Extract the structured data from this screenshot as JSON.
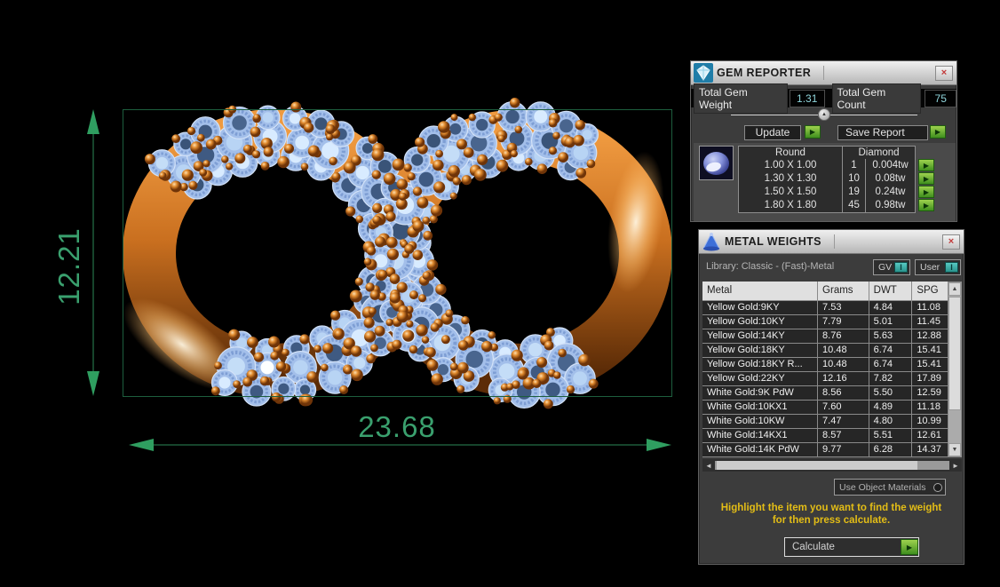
{
  "viewport": {
    "dim_width": "23.68",
    "dim_height": "12.21"
  },
  "colors": {
    "dimension_green": "#3aa06e",
    "value_cyan": "#8fd4da",
    "hint_yellow": "#e3bd16",
    "action_green": "#3f8f1e",
    "metal_orange": "#c96f1f",
    "gem_blue": "#a3bfea"
  },
  "gem_reporter": {
    "title": "GEM REPORTER",
    "close_glyph": "×",
    "total_weight_label": "Total Gem Weight",
    "total_weight_value": "1.31",
    "total_count_label": "Total Gem Count",
    "total_count_value": "75",
    "update_label": "Update",
    "save_report_label": "Save Report",
    "run_glyph": "▶",
    "table": {
      "shape_header": "Round",
      "type_header": "Diamond",
      "rows": [
        {
          "size": "1.00 X 1.00",
          "count": "1",
          "weight": "0.004tw"
        },
        {
          "size": "1.30 X 1.30",
          "count": "10",
          "weight": "0.08tw"
        },
        {
          "size": "1.50 X 1.50",
          "count": "19",
          "weight": "0.24tw"
        },
        {
          "size": "1.80 X 1.80",
          "count": "45",
          "weight": "0.98tw"
        }
      ]
    }
  },
  "metal_weights": {
    "title": "METAL WEIGHTS",
    "close_glyph": "×",
    "library_label": "Library: Classic - (Fast)-Metal",
    "gv_label": "GV",
    "user_label": "User",
    "toggle_glyph": "I",
    "columns": [
      "Metal",
      "Grams",
      "DWT",
      "SPG"
    ],
    "rows": [
      [
        "Yellow Gold:9KY",
        "7.53",
        "4.84",
        "11.08"
      ],
      [
        "Yellow Gold:10KY",
        "7.79",
        "5.01",
        "11.45"
      ],
      [
        "Yellow Gold:14KY",
        "8.76",
        "5.63",
        "12.88"
      ],
      [
        "Yellow Gold:18KY",
        "10.48",
        "6.74",
        "15.41"
      ],
      [
        "Yellow Gold:18KY R...",
        "10.48",
        "6.74",
        "15.41"
      ],
      [
        "Yellow Gold:22KY",
        "12.16",
        "7.82",
        "17.89"
      ],
      [
        "White Gold:9K PdW",
        "8.56",
        "5.50",
        "12.59"
      ],
      [
        "White Gold:10KX1",
        "7.60",
        "4.89",
        "11.18"
      ],
      [
        "White Gold:10KW",
        "7.47",
        "4.80",
        "10.99"
      ],
      [
        "White Gold:14KX1",
        "8.57",
        "5.51",
        "12.61"
      ],
      [
        "White Gold:14K PdW",
        "9.77",
        "6.28",
        "14.37"
      ]
    ],
    "scroll_up_glyph": "▲",
    "scroll_down_glyph": "▼",
    "scroll_left_glyph": "◄",
    "scroll_right_glyph": "►",
    "use_object_materials_label": "Use Object Materials",
    "hint_line1": "Highlight the item you want to find the weight",
    "hint_line2": "for then press calculate.",
    "calculate_label": "Calculate",
    "run_glyph": "▶"
  }
}
